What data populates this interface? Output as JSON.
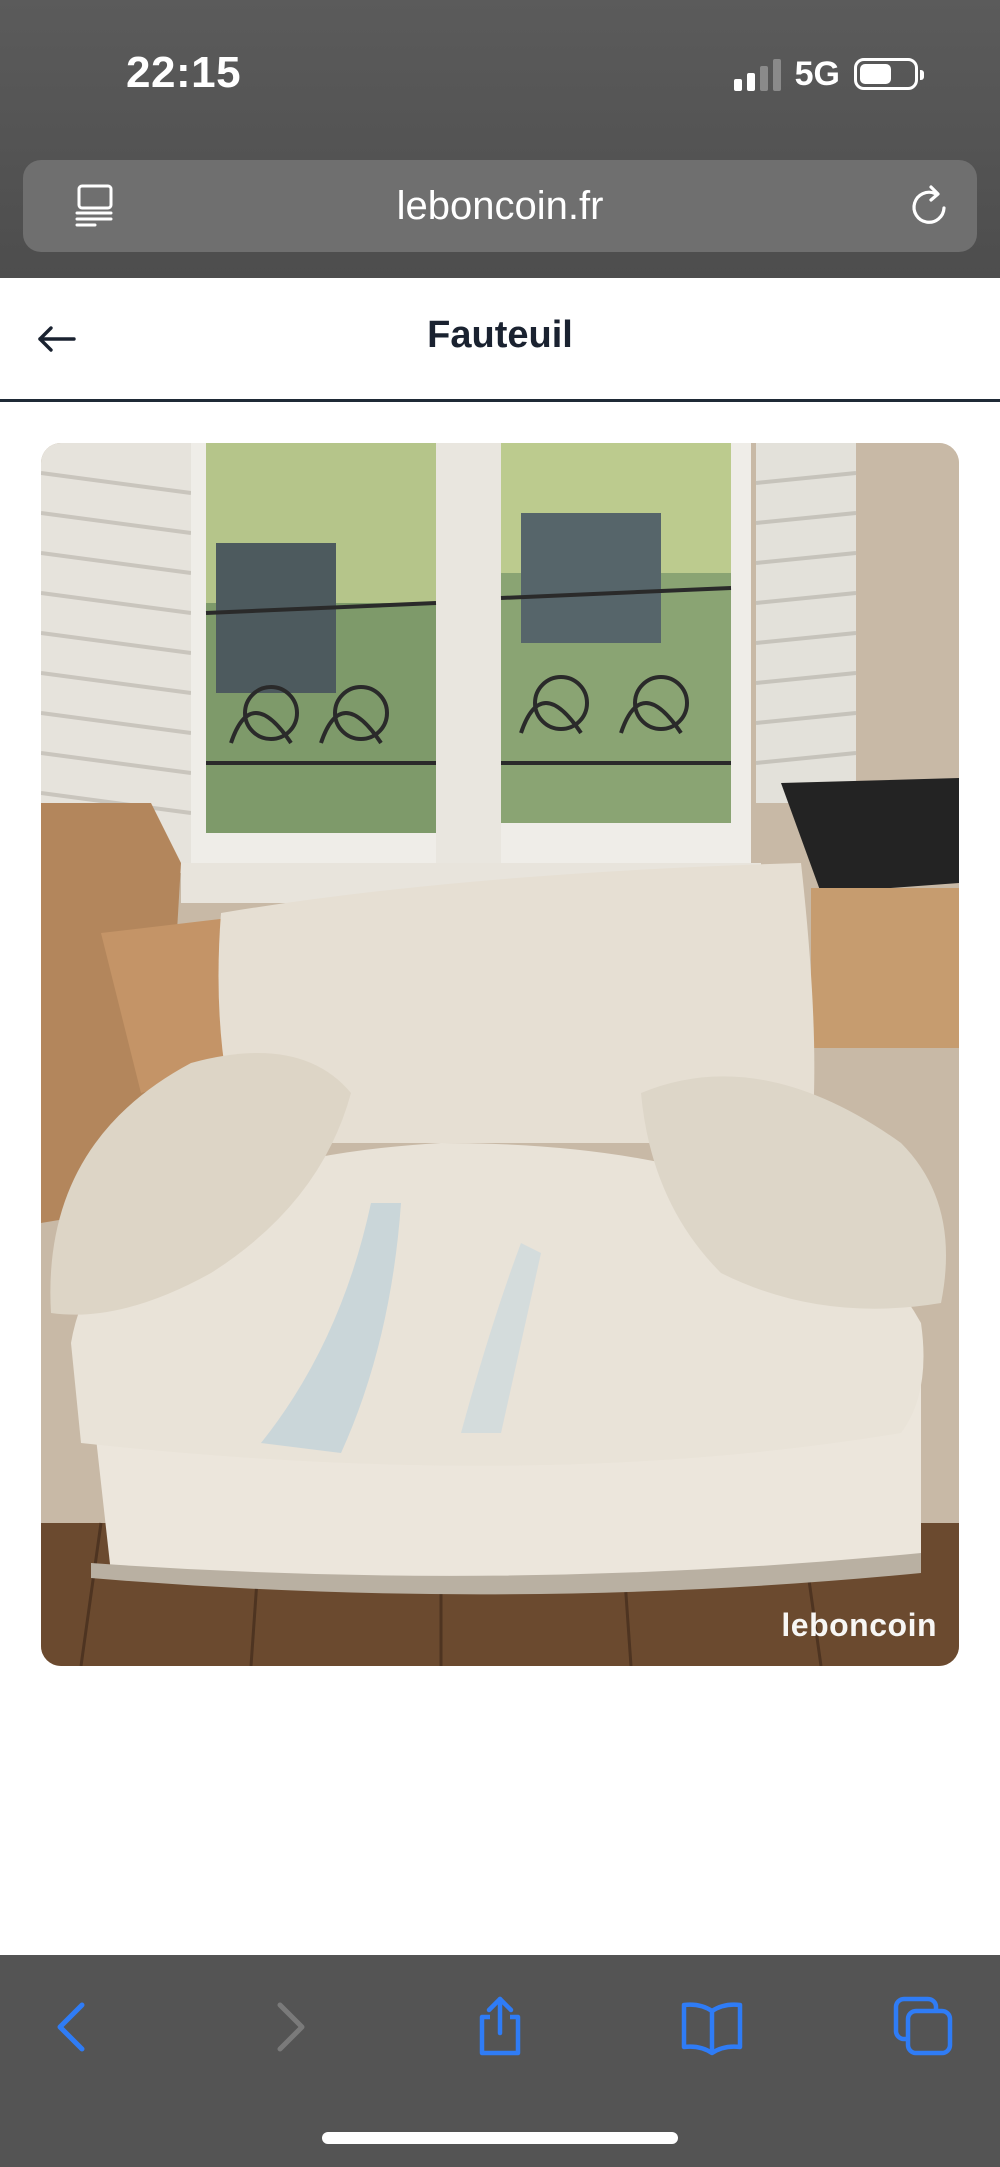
{
  "status_bar": {
    "time": "22:15",
    "network": "5G",
    "signal_bars_filled": 2,
    "signal_bars_total": 4,
    "battery_level": 0.6
  },
  "browser": {
    "url": "leboncoin.fr",
    "reader_icon": "reader-mode-icon",
    "reload_icon": "reload-icon"
  },
  "page": {
    "title": "Fauteuil",
    "back_icon": "back-arrow-icon"
  },
  "photo": {
    "watermark": "leboncoin"
  },
  "toolbar": {
    "items": [
      "back-icon",
      "forward-icon",
      "share-icon",
      "bookmarks-icon",
      "tabs-icon"
    ]
  },
  "colors": {
    "chrome_bg": "#545454",
    "accent": "#2f7cf6",
    "title_text": "#1a2230"
  }
}
